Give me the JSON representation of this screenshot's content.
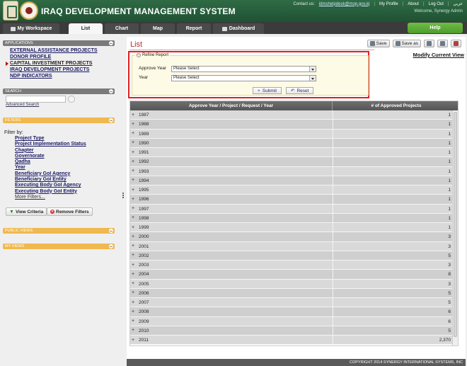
{
  "header": {
    "app_title": "IRAQ DEVELOPMENT MANAGEMENT SYSTEM",
    "contact_label": "Contact us:",
    "contact_email": "idmshelpdesk@mop.gov.iq",
    "my_profile": "My Profile",
    "about": "About",
    "log_out": "Log Out",
    "language": "عربي",
    "welcome": "Welcome, Synergy Admin"
  },
  "nav": {
    "my_workspace": "My Workspace",
    "list": "List",
    "chart": "Chart",
    "map": "Map",
    "report": "Report",
    "dashboard": "Dashboard",
    "help": "Help"
  },
  "sidebar": {
    "applications_title": "APPLICATIONS",
    "applications": [
      "EXTERNAL ASSISTANCE PROJECTS",
      "DONOR PROFILE",
      "CAPITAL INVESTMENT PROJECTS",
      "IRAQ DEVELOPMENT PROJECTS",
      "NDP INDICATORS"
    ],
    "search_title": "SEARCH",
    "advanced_search": "Advanced Search",
    "filters_title": "FILTERS",
    "filter_by": "Filter by:",
    "filters": [
      "Project Type",
      "Project Implementation Status",
      "Chapter",
      "Governorate",
      "Qadha",
      "Year",
      "Beneficiary GoI Agency",
      "Beneficiary GoI Entity",
      "Executing Body GoI Agency",
      "Executing Body GoI Entity",
      "More Filters..."
    ],
    "view_criteria": "View Criteria",
    "remove_filters": "Remove Filters",
    "public_views": "PUBLIC VIEWS",
    "my_views": "MY VIEWS"
  },
  "main": {
    "title": "List",
    "save": "Save",
    "save_as": "Save as",
    "modify_view": "Modify Current View",
    "refine": {
      "legend": "Refine Report",
      "approve_year_label": "Approve Year",
      "approve_year_value": "Please Select",
      "year_label": "Year",
      "year_value": "Please Select",
      "submit": "Submit",
      "reset": "Reset"
    },
    "table": {
      "col1": "Approve Year / Project / Request / Year",
      "col2": "# of Approved Projects",
      "rows": [
        {
          "year": "1987",
          "count": "1"
        },
        {
          "year": "1988",
          "count": "1"
        },
        {
          "year": "1989",
          "count": "1"
        },
        {
          "year": "1990",
          "count": "1"
        },
        {
          "year": "1991",
          "count": "1"
        },
        {
          "year": "1992",
          "count": "1"
        },
        {
          "year": "1993",
          "count": "1"
        },
        {
          "year": "1994",
          "count": "1"
        },
        {
          "year": "1995",
          "count": "1"
        },
        {
          "year": "1996",
          "count": "1"
        },
        {
          "year": "1997",
          "count": "1"
        },
        {
          "year": "1998",
          "count": "1"
        },
        {
          "year": "1999",
          "count": "1"
        },
        {
          "year": "2000",
          "count": "3"
        },
        {
          "year": "2001",
          "count": "3"
        },
        {
          "year": "2002",
          "count": "5"
        },
        {
          "year": "2003",
          "count": "3"
        },
        {
          "year": "2004",
          "count": "8"
        },
        {
          "year": "2005",
          "count": "3"
        },
        {
          "year": "2006",
          "count": "5"
        },
        {
          "year": "2007",
          "count": "5"
        },
        {
          "year": "2008",
          "count": "6"
        },
        {
          "year": "2009",
          "count": "6"
        },
        {
          "year": "2010",
          "count": "5"
        },
        {
          "year": "2011",
          "count": "2,370"
        }
      ]
    }
  },
  "footer": "COPYRIGHT 2014 SYNERGY INTERNATIONAL SYSTEMS, INC"
}
